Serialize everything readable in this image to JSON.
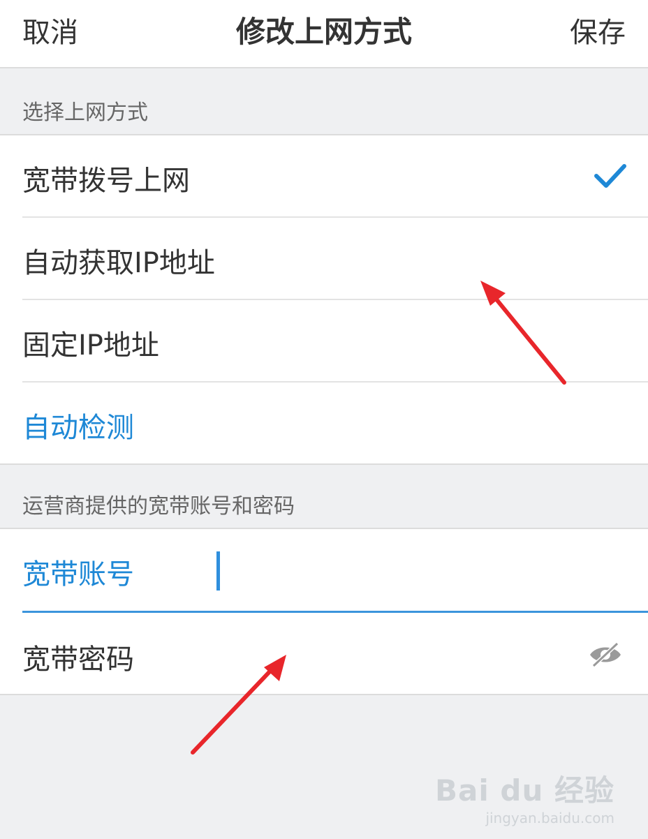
{
  "header": {
    "cancel_label": "取消",
    "title": "修改上网方式",
    "save_label": "保存"
  },
  "section1": {
    "label": "选择上网方式",
    "options": [
      {
        "label": "宽带拨号上网",
        "selected": true
      },
      {
        "label": "自动获取IP地址",
        "selected": false
      },
      {
        "label": "固定IP地址",
        "selected": false
      },
      {
        "label": "自动检测",
        "selected": false
      }
    ]
  },
  "section2": {
    "label": "运营商提供的宽带账号和密码",
    "account_label": "宽带账号",
    "account_value": "",
    "password_label": "宽带密码",
    "password_value": ""
  },
  "icons": {
    "selected_check": "check-icon",
    "password_visibility": "eye-off-icon"
  },
  "colors": {
    "accent": "#1e88d6",
    "annotation_arrow": "#e8262b"
  },
  "watermark": {
    "main": "Bai du 经验",
    "sub": "jingyan.baidu.com"
  }
}
